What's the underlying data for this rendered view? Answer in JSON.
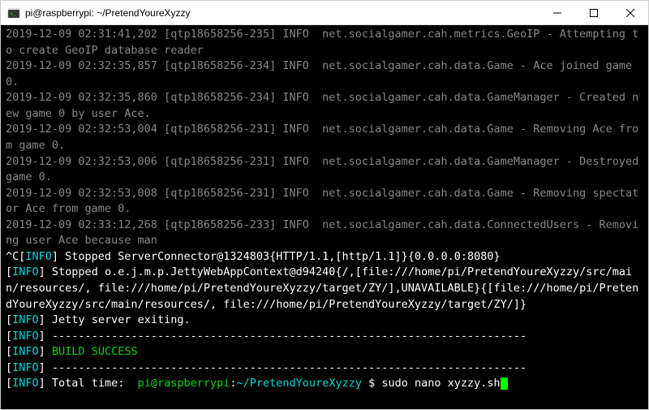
{
  "window": {
    "title": "pi@raspberrypi: ~/PretendYoureXyzzy"
  },
  "log": {
    "l1a": "2019-12-09 02:31:41,202 [qtp18658256-235] INFO  net.socialgamer.cah.metrics.GeoIP - Attempting to create GeoIP database reader",
    "l2a": "2019-12-09 02:32:35,857 [qtp18658256-234] INFO  net.socialgamer.cah.data.Game - Ace joined game 0.",
    "l3a": "2019-12-09 02:32:35,860 [qtp18658256-234] INFO  net.socialgamer.cah.data.GameManager - Created new game 0 by user Ace.",
    "l4a": "2019-12-09 02:32:53,004 [qtp18658256-231] INFO  net.socialgamer.cah.data.Game - Removing Ace from game 0.",
    "l5a": "2019-12-09 02:32:53,006 [qtp18658256-231] INFO  net.socialgamer.cah.data.GameManager - Destroyed game 0.",
    "l6a": "2019-12-09 02:32:53,008 [qtp18658256-231] INFO  net.socialgamer.cah.data.Game - Removing spectator Ace from game 0.",
    "l7a": "2019-12-09 02:33:12,268 [qtp18658256-233] INFO  net.socialgamer.cah.data.ConnectedUsers - Removing user Ace because man",
    "stop1_pre": "^C[",
    "info_tag": "INFO",
    "stop1_post": "] Stopped ServerConnector@1324803{HTTP/1.1,[http/1.1]}{0.0.0.0:8080}",
    "bracket_open": "[",
    "bracket_close": "] ",
    "stop2": "Stopped o.e.j.m.p.JettyWebAppContext@d94240{/,[file:///home/pi/PretendYoureXyzzy/src/main/resources/, file:///home/pi/PretendYoureXyzzy/target/ZY/],UNAVAILABLE}{[file:///home/pi/PretendYoureXyzzy/src/main/resources/, file:///home/pi/PretendYoureXyzzy/target/ZY/]}",
    "jetty_exit": "Jetty server exiting.",
    "dashes": "------------------------------------------------------------------------",
    "build_success": "BUILD SUCCESS",
    "total_time_label": "Total time:  ",
    "prompt_user": "pi@raspberrypi",
    "prompt_sep": ":",
    "prompt_path": "~/PretendYoureXyzzy",
    "prompt_dollar": " $ ",
    "command": "sudo nano xyzzy.sh"
  }
}
